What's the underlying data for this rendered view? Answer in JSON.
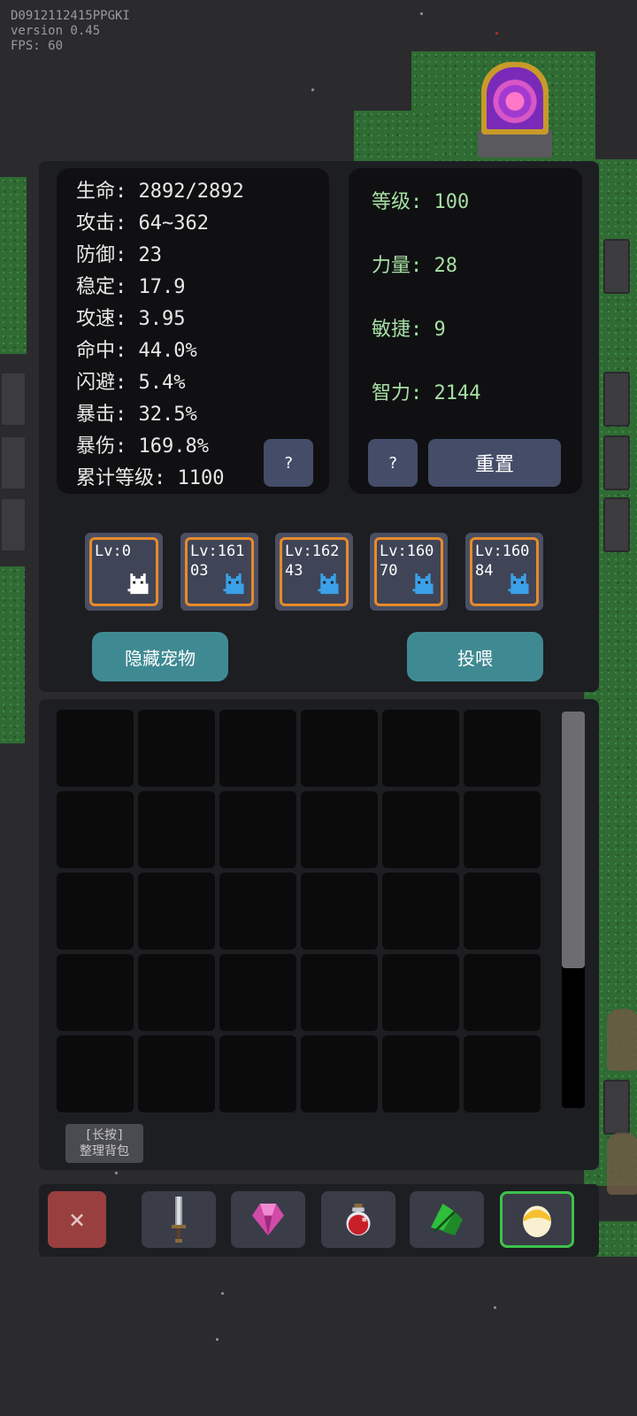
{
  "debug": {
    "device_id": "D0912112415PPGKI",
    "version": "version 0.45",
    "fps": "FPS: 60"
  },
  "stats": [
    {
      "label": "生命",
      "value": "2892/2892"
    },
    {
      "label": "攻击",
      "value": "64~362"
    },
    {
      "label": "防御",
      "value": "23"
    },
    {
      "label": "稳定",
      "value": "17.9"
    },
    {
      "label": "攻速",
      "value": "3.95"
    },
    {
      "label": "命中",
      "value": "44.0%"
    },
    {
      "label": "闪避",
      "value": "5.4%"
    },
    {
      "label": "暴击",
      "value": "32.5%"
    },
    {
      "label": "暴伤",
      "value": "169.8%"
    },
    {
      "label": "累计等级",
      "value": "1100"
    }
  ],
  "stat_lines": [
    "生命: 2892/2892",
    "攻击: 64~362",
    "防御: 23",
    "稳定: 17.9",
    "攻速: 3.95",
    "命中: 44.0%",
    "闪避: 5.4%",
    "暴击: 32.5%",
    "暴伤: 169.8%",
    "累计等级: 1100"
  ],
  "attributes": {
    "level": "等级: 100",
    "strength": "力量: 28",
    "agility": "敏捷: 9",
    "intelligence": "智力: 2144"
  },
  "buttons": {
    "stats_help": "?",
    "attr_help": "?",
    "reset": "重置",
    "hide_pets": "隐藏宠物",
    "feed": "投喂",
    "sort_bag": "[长按]\n整理背包",
    "close": "×"
  },
  "pets": [
    {
      "level_text": "Lv:0",
      "color": "#ffffff"
    },
    {
      "level_text": "Lv:161\n03",
      "color": "#3aa0e8"
    },
    {
      "level_text": "Lv:162\n43",
      "color": "#3aa0e8"
    },
    {
      "level_text": "Lv:160\n70",
      "color": "#3aa0e8"
    },
    {
      "level_text": "Lv:160\n84",
      "color": "#3aa0e8"
    }
  ],
  "inventory": {
    "columns": 6,
    "visible_rows": 5
  },
  "tabs": [
    {
      "name": "sword-icon"
    },
    {
      "name": "gem-icon"
    },
    {
      "name": "potion-icon"
    },
    {
      "name": "leaf-icon"
    },
    {
      "name": "egg-icon",
      "active": true
    }
  ]
}
